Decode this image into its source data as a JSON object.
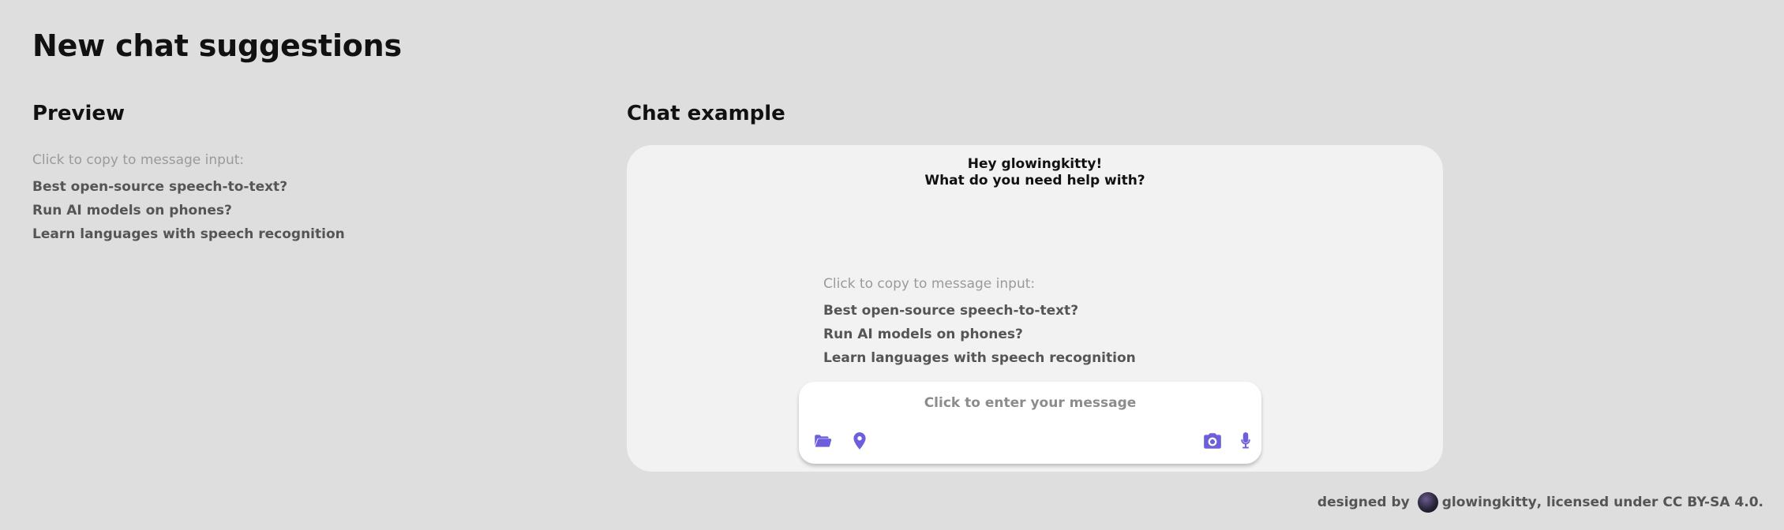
{
  "page": {
    "title": "New chat suggestions"
  },
  "preview": {
    "title": "Preview",
    "hint": "Click to copy to message input:",
    "suggestions": [
      "Best open-source speech-to-text?",
      "Run AI models on phones?",
      "Learn languages with speech recognition"
    ]
  },
  "chat_example": {
    "title": "Chat example",
    "greeting_line1": "Hey glowingkitty!",
    "greeting_line2": "What do you need help with?",
    "hint": "Click to copy to message input:",
    "suggestions": [
      "Best open-source speech-to-text?",
      "Run AI models on phones?",
      "Learn languages with speech recognition"
    ],
    "input": {
      "placeholder": "Click to enter your message",
      "icons": {
        "folder": "folder-icon",
        "location": "location-pin-icon",
        "camera": "camera-icon",
        "mic": "microphone-icon"
      },
      "icon_color": "#6d5fdb"
    }
  },
  "footer": {
    "designed_by": "designed by",
    "author": "glowingkitty",
    "license": ", licensed under CC BY-SA 4.0."
  },
  "colors": {
    "background": "#dedede",
    "card": "#f2f2f2",
    "accent": "#6d5fdb"
  }
}
